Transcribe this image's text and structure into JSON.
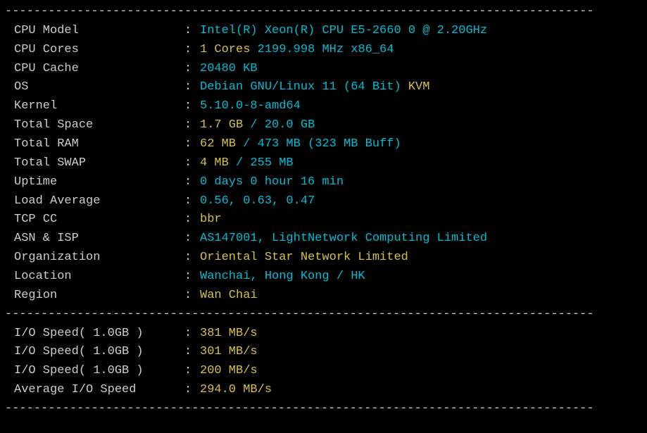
{
  "divider": "----------------------------------------------------------------------------------",
  "system": {
    "cpu_model": {
      "label": "CPU Model",
      "value": "Intel(R) Xeon(R) CPU E5-2660 0 @ 2.20GHz"
    },
    "cpu_cores": {
      "label": "CPU Cores",
      "cores": "1 Cores",
      "freq": " 2199.998 MHz x86_64"
    },
    "cpu_cache": {
      "label": "CPU Cache",
      "value": "20480 KB"
    },
    "os": {
      "label": "OS",
      "name": "Debian GNU/Linux 11 (64 Bit)",
      "virt": " KVM"
    },
    "kernel": {
      "label": "Kernel",
      "value": "5.10.0-8-amd64"
    },
    "total_space": {
      "label": "Total Space",
      "used": "1.7 GB",
      "sep": " / ",
      "total": "20.0 GB"
    },
    "total_ram": {
      "label": "Total RAM",
      "used": "62 MB",
      "sep": " / ",
      "total": "473 MB",
      "buff": " (323 MB Buff)"
    },
    "total_swap": {
      "label": "Total SWAP",
      "used": "4 MB",
      "sep": " / ",
      "total": "255 MB"
    },
    "uptime": {
      "label": "Uptime",
      "value": "0 days 0 hour 16 min"
    },
    "load_avg": {
      "label": "Load Average",
      "value": "0.56, 0.63, 0.47"
    },
    "tcp_cc": {
      "label": "TCP CC",
      "value": "bbr"
    },
    "asn_isp": {
      "label": "ASN & ISP",
      "value": "AS147001, LightNetwork Computing Limited"
    },
    "organization": {
      "label": "Organization",
      "value": "Oriental Star Network Limited"
    },
    "location": {
      "label": "Location",
      "value": "Wanchai, Hong Kong / HK"
    },
    "region": {
      "label": "Region",
      "value": "Wan Chai"
    }
  },
  "io": {
    "speed1": {
      "label": "I/O Speed( 1.0GB )",
      "value": "381 MB/s"
    },
    "speed2": {
      "label": "I/O Speed( 1.0GB )",
      "value": "301 MB/s"
    },
    "speed3": {
      "label": "I/O Speed( 1.0GB )",
      "value": "200 MB/s"
    },
    "avg": {
      "label": "Average I/O Speed",
      "value": "294.0 MB/s"
    }
  }
}
